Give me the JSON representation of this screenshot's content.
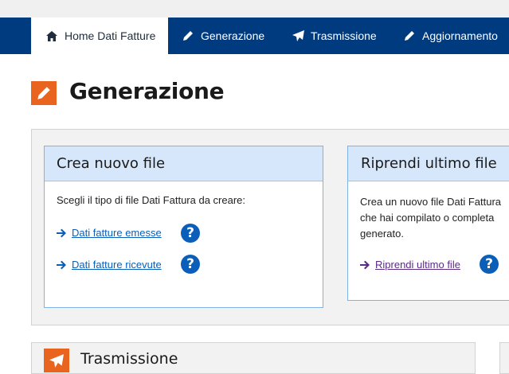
{
  "nav": {
    "tabs": [
      {
        "label": "Home Dati Fatture",
        "icon": "home-icon",
        "active": true
      },
      {
        "label": "Generazione",
        "icon": "pencil-icon",
        "active": false
      },
      {
        "label": "Trasmissione",
        "icon": "paper-plane-icon",
        "active": false
      },
      {
        "label": "Aggiornamento",
        "icon": "pencil-icon",
        "active": false
      }
    ]
  },
  "page": {
    "title": "Generazione",
    "title_icon": "pencil-icon"
  },
  "cards": {
    "new_file": {
      "title": "Crea nuovo file",
      "description": "Scegli il tipo di file Dati Fattura da creare:",
      "links": [
        {
          "label": "Dati fatture emesse",
          "help": "?"
        },
        {
          "label": "Dati fatture ricevute",
          "help": "?"
        }
      ]
    },
    "resume_file": {
      "title": "Riprendi ultimo file",
      "description_lines": [
        "Crea un nuovo file Dati Fattura",
        "che hai compilato o completa",
        "generato."
      ],
      "link": {
        "label": "Riprendi ultimo file",
        "help": "?"
      }
    }
  },
  "lower_section": {
    "title": "Trasmissione",
    "icon": "paper-plane-icon"
  },
  "colors": {
    "navbar": "#003b80",
    "accent_orange": "#e9641e",
    "link_blue": "#0b5fb8",
    "card_header": "#d6e7fb",
    "visited_link": "#5b2a86"
  }
}
